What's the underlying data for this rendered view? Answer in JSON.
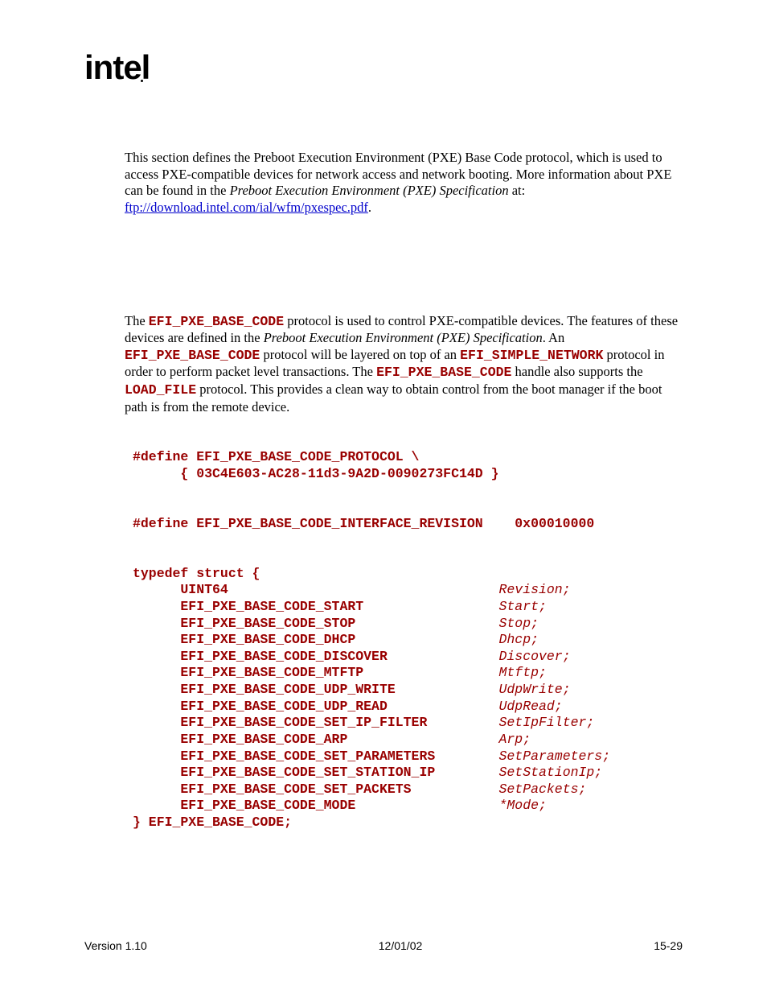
{
  "logo": "intel",
  "para1_a": "This section defines the Preboot Execution Environment (PXE) Base Code protocol, which is used to access PXE-compatible devices for network access and network booting.  More information about PXE can be found in the ",
  "para1_b": "Preboot Execution Environment (PXE) Specification",
  "para1_c": " at: ",
  "para1_link": "ftp://download.intel.com/ial/wfm/pxespec.pdf",
  "para1_d": ".",
  "para2_a": "The ",
  "para2_code1": "EFI_PXE_BASE_CODE",
  "para2_b": " protocol is used to control PXE-compatible devices.  The features of these devices are defined in the ",
  "para2_italic": "Preboot Execution Environment (PXE) Specification",
  "para2_c": ".  An ",
  "para2_code2": "EFI_PXE_BASE_CODE",
  "para2_d": " protocol will be layered on top of an ",
  "para2_code3": "EFI_SIMPLE_NETWORK",
  "para2_e": " protocol in order to perform packet level transactions.  The ",
  "para2_code4": "EFI_PXE_BASE_CODE",
  "para2_f": " handle also supports the ",
  "para2_code5": "LOAD_FILE",
  "para2_g": " protocol.  This provides a clean way to obtain control from the boot manager if the boot path is from the remote device.",
  "code": {
    "l1": "#define EFI_PXE_BASE_CODE_PROTOCOL \\",
    "l2": "      { 03C4E603-AC28-11d3-9A2D-0090273FC14D }",
    "l3": "#define EFI_PXE_BASE_CODE_INTERFACE_REVISION    0x00010000",
    "l4": "typedef struct {",
    "struct": [
      {
        "type": "UINT64",
        "name": "Revision;"
      },
      {
        "type": "EFI_PXE_BASE_CODE_START",
        "name": "Start;"
      },
      {
        "type": "EFI_PXE_BASE_CODE_STOP",
        "name": "Stop;"
      },
      {
        "type": "EFI_PXE_BASE_CODE_DHCP",
        "name": "Dhcp;"
      },
      {
        "type": "EFI_PXE_BASE_CODE_DISCOVER",
        "name": "Discover;"
      },
      {
        "type": "EFI_PXE_BASE_CODE_MTFTP",
        "name": "Mtftp;"
      },
      {
        "type": "EFI_PXE_BASE_CODE_UDP_WRITE",
        "name": "UdpWrite;"
      },
      {
        "type": "EFI_PXE_BASE_CODE_UDP_READ",
        "name": "UdpRead;"
      },
      {
        "type": "EFI_PXE_BASE_CODE_SET_IP_FILTER",
        "name": "SetIpFilter;"
      },
      {
        "type": "EFI_PXE_BASE_CODE_ARP",
        "name": "Arp;"
      },
      {
        "type": "EFI_PXE_BASE_CODE_SET_PARAMETERS",
        "name": "SetParameters;"
      },
      {
        "type": "EFI_PXE_BASE_CODE_SET_STATION_IP",
        "name": "SetStationIp;"
      },
      {
        "type": "EFI_PXE_BASE_CODE_SET_PACKETS",
        "name": "SetPackets;"
      },
      {
        "type": "EFI_PXE_BASE_CODE_MODE",
        "name": "*Mode;"
      }
    ],
    "l5": "} EFI_PXE_BASE_CODE;"
  },
  "footer": {
    "left": "Version 1.10",
    "center": "12/01/02",
    "right": "15-29"
  }
}
